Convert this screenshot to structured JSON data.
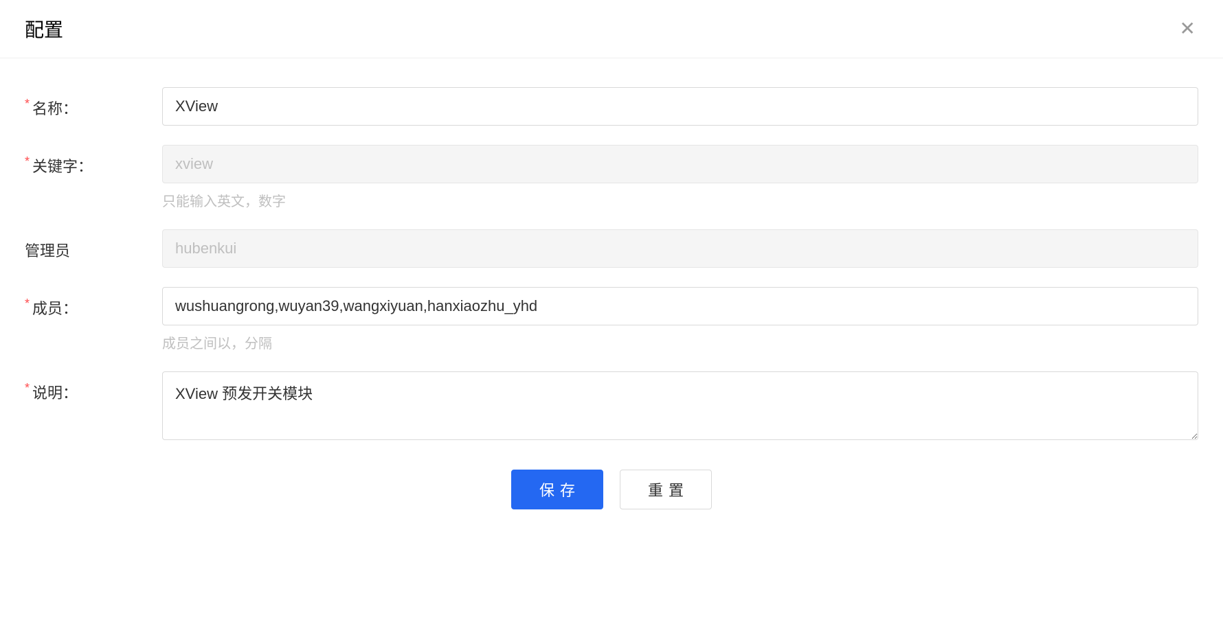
{
  "modal": {
    "title": "配置",
    "close_label": "✕"
  },
  "form": {
    "name": {
      "label": "名称：",
      "value": "XView"
    },
    "keyword": {
      "label": "关键字：",
      "value": "xview",
      "hint": "只能输入英文，数字"
    },
    "admin": {
      "label": "管理员",
      "value": "hubenkui"
    },
    "members": {
      "label": "成员：",
      "value": "wushuangrong,wuyan39,wangxiyuan,hanxiaozhu_yhd",
      "hint": "成员之间以，分隔"
    },
    "description": {
      "label": "说明：",
      "value": "XView 预发开关模块"
    }
  },
  "actions": {
    "save": "保存",
    "reset": "重置"
  }
}
